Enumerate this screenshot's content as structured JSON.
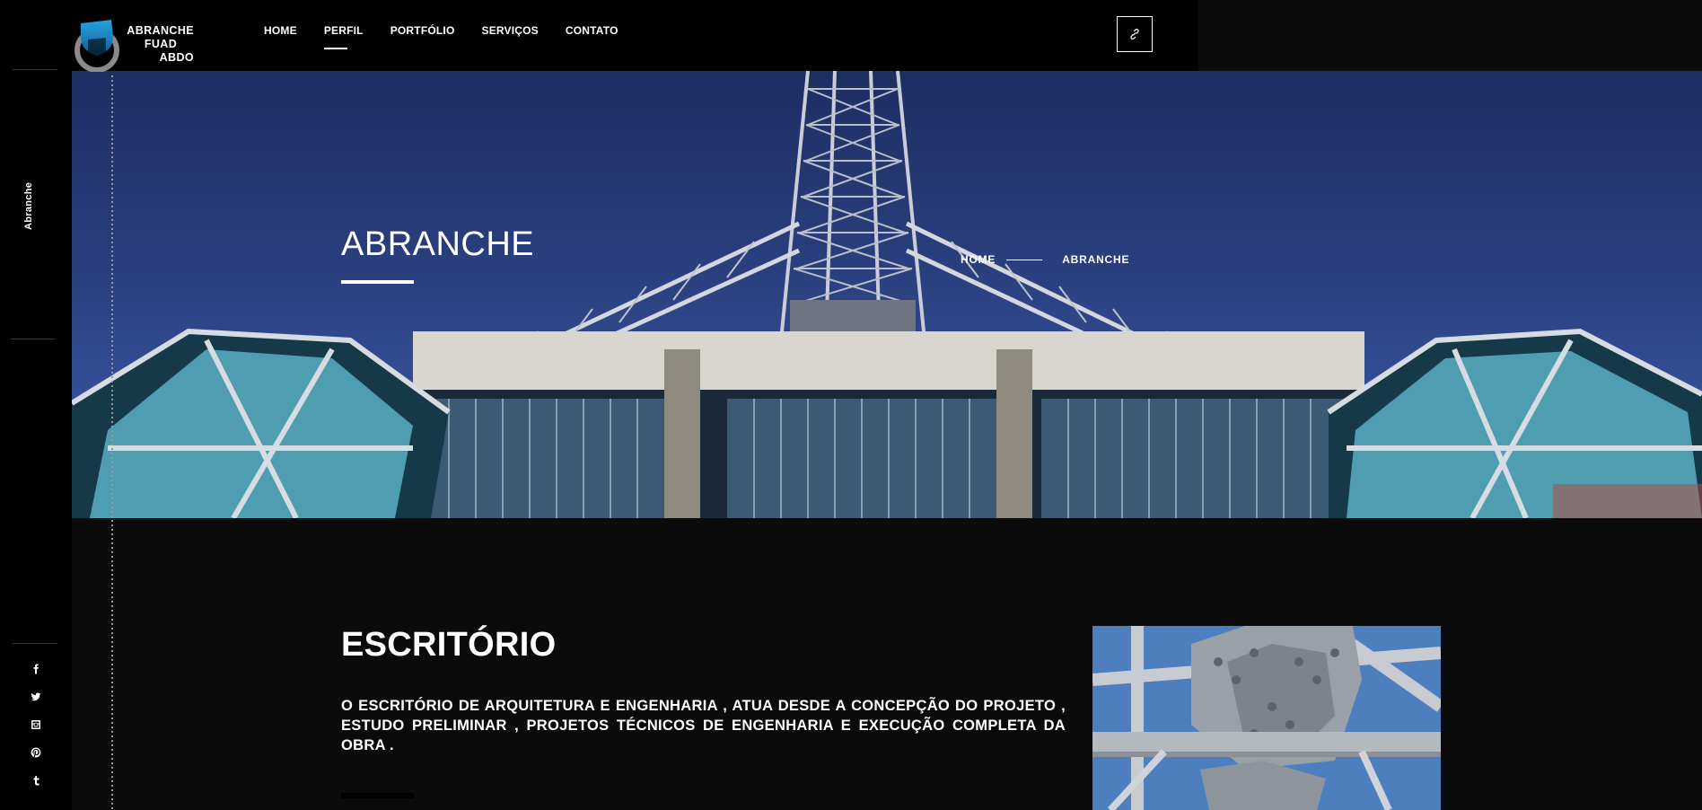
{
  "brand": {
    "logo_lines": [
      "ABRANCHE",
      "FUAD",
      "ABDO"
    ],
    "accent_color": "#1e88c7"
  },
  "nav": {
    "items": [
      {
        "label": "HOME",
        "active": false
      },
      {
        "label": "PERFIL",
        "active": true
      },
      {
        "label": "PORTFÓLIO",
        "active": false
      },
      {
        "label": "SERVIÇOS",
        "active": false
      },
      {
        "label": "CONTATO",
        "active": false
      }
    ],
    "share_icon": "share-icon"
  },
  "sidebar": {
    "vertical_label": "Abranche",
    "social": [
      "facebook-icon",
      "twitter-icon",
      "instagram-icon",
      "pinterest-icon",
      "tumblr-icon"
    ]
  },
  "hero": {
    "title": "ABRANCHE",
    "breadcrumb": {
      "home": "HOME",
      "current": "ABRANCHE"
    }
  },
  "section": {
    "title": "ESCRITÓRIO",
    "text": "O ESCRITÓRIO  DE ARQUITETURA E ENGENHARIA , ATUA DESDE A CONCEPÇÃO DO PROJETO , ESTUDO PRELIMINAR , PROJETOS TÉCNICOS DE ENGENHARIA E EXECUÇÃO COMPLETA DA OBRA ."
  }
}
